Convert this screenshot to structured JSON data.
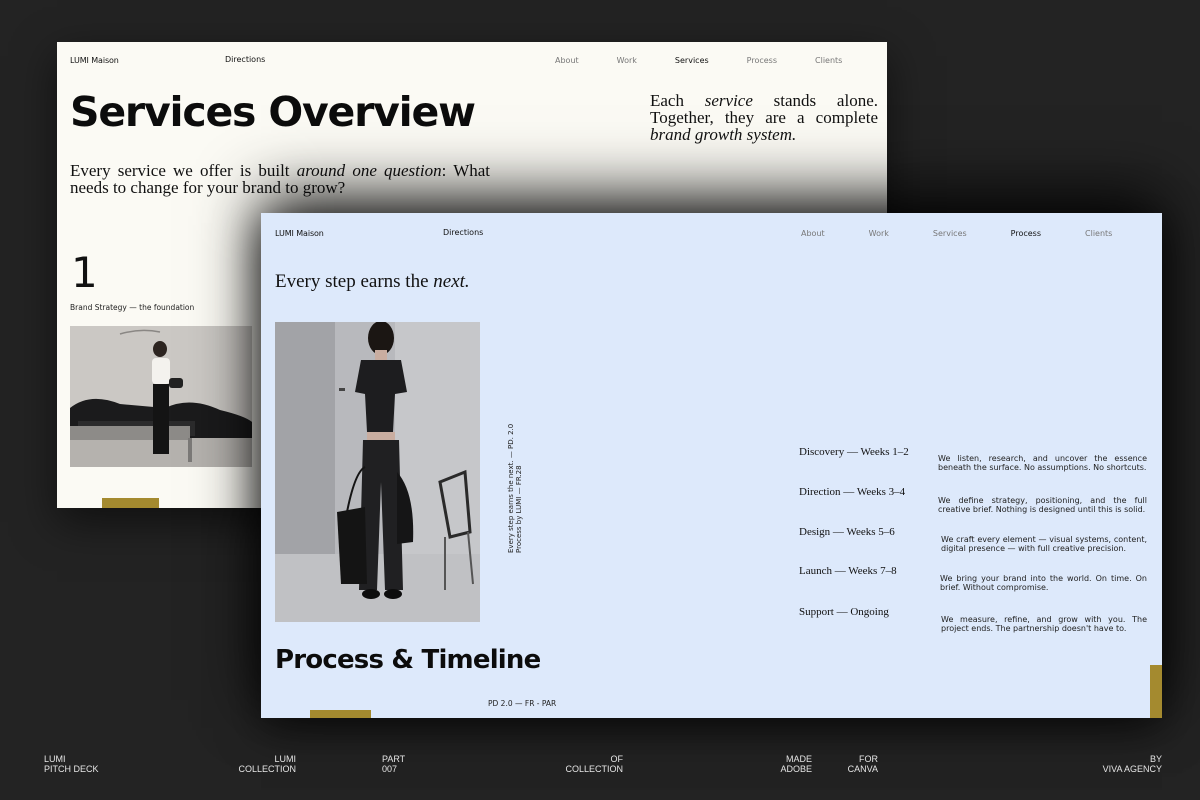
{
  "back_slide": {
    "brand": "LUMI Maison",
    "directions": "Directions",
    "nav": [
      "About",
      "Work",
      "Services",
      "Process",
      "Clients"
    ],
    "active_nav": "Services",
    "title": "Services Overview",
    "quote_pre": "Each ",
    "quote_em1": "service",
    "quote_mid": " stands alone. Together, they are a complete ",
    "quote_em2": "brand growth system.",
    "sub_pre": "Every service we offer is built ",
    "sub_em": "around one question",
    "sub_post": ": What needs to change for your brand to grow?",
    "number": "1",
    "number_caption": "Brand Strategy — the foundation",
    "accent_color": "#a48a2f"
  },
  "front_slide": {
    "brand": "LUMI Maison",
    "directions": "Directions",
    "nav": [
      "About",
      "Work",
      "Services",
      "Process",
      "Clients"
    ],
    "active_nav": "Process",
    "heading_pre": "Every step earns the ",
    "heading_em": "next.",
    "vertical_line1": "Every step earns the next. — PD. 2.0",
    "vertical_line2": "Process by LUMI — FR.28",
    "title": "Process & Timeline",
    "footer_code": "PD 2.0 — FR - PAR",
    "steps": [
      {
        "title": "Discovery — Weeks 1–2",
        "desc": "We listen, research, and uncover the essence beneath the surface. No assumptions. No shortcuts."
      },
      {
        "title": "Direction — Weeks 3–4",
        "desc": "We define strategy, positioning, and the full creative brief. Nothing is designed until this is solid."
      },
      {
        "title": "Design — Weeks 5–6",
        "desc": "We craft every element — visual systems, content, digital presence — with full creative precision."
      },
      {
        "title": "Launch — Weeks 7–8",
        "desc": "We bring your brand into the world. On time. On brief. Without compromise."
      },
      {
        "title": "Support — Ongoing",
        "desc": "We measure, refine, and grow with you. The project ends. The partnership doesn't have to."
      }
    ],
    "background_color": "#dde9fb"
  },
  "footer": {
    "pitch": [
      "LUMI",
      "PITCH DECK"
    ],
    "collection": [
      "LUMI",
      "COLLECTION"
    ],
    "part": [
      "PART",
      "007"
    ],
    "of": [
      "OF",
      "COLLECTION"
    ],
    "made": [
      "MADE",
      "ADOBE"
    ],
    "for": [
      "FOR",
      "CANVA"
    ],
    "by": [
      "BY",
      "VIVA AGENCY"
    ]
  }
}
